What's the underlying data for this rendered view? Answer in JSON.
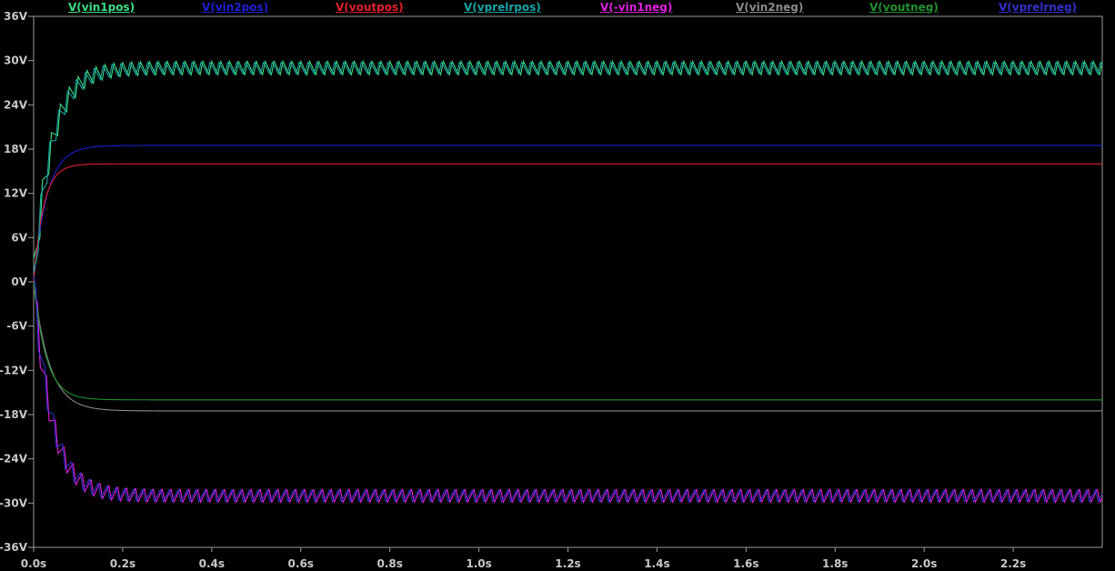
{
  "chart_data": {
    "type": "line",
    "background": "#000000",
    "axis_color": "#9a9a9a",
    "x_ticks": [
      "0.0s",
      "0.2s",
      "0.4s",
      "0.6s",
      "0.8s",
      "1.0s",
      "1.2s",
      "1.4s",
      "1.6s",
      "1.8s",
      "2.0s",
      "2.2s"
    ],
    "y_ticks": [
      "36V",
      "30V",
      "24V",
      "18V",
      "12V",
      "6V",
      "0V",
      "-6V",
      "-12V",
      "-18V",
      "-24V",
      "-30V",
      "-36V"
    ],
    "xlim": [
      0,
      2.4
    ],
    "ylim": [
      -36,
      36
    ],
    "x_unit": "s",
    "y_unit": "V",
    "legend_placement": "top",
    "ripple_frequency_hz": 50,
    "series": [
      {
        "name": "V(vin1pos)",
        "color": "#3ddc84",
        "kind": "ripple",
        "final": 29,
        "amp": 0.9,
        "tau": 0.04
      },
      {
        "name": "V(vin2pos)",
        "color": "#1f1fd6",
        "kind": "smooth",
        "final": 18.5,
        "tau": 0.03
      },
      {
        "name": "V(voutpos)",
        "color": "#e0202a",
        "kind": "smooth",
        "final": 16,
        "tau": 0.022
      },
      {
        "name": "V(vprelrpos)",
        "color": "#1aa3a3",
        "kind": "ripple",
        "final": 29,
        "amp": 0.8,
        "tau": 0.04
      },
      {
        "name": "V(-vin1neg)",
        "color": "#e020e0",
        "kind": "ripple",
        "final": -29,
        "amp": 0.9,
        "tau": 0.04
      },
      {
        "name": "V(vin2neg)",
        "color": "#8a8a8a",
        "kind": "smooth",
        "final": -17.5,
        "tau": 0.035
      },
      {
        "name": "V(voutneg)",
        "color": "#1f8f2f",
        "kind": "smooth",
        "final": -16,
        "tau": 0.028
      },
      {
        "name": "V(vprelrneg)",
        "color": "#3030c8",
        "kind": "ripple",
        "final": -29,
        "amp": 0.8,
        "tau": 0.04
      }
    ]
  }
}
